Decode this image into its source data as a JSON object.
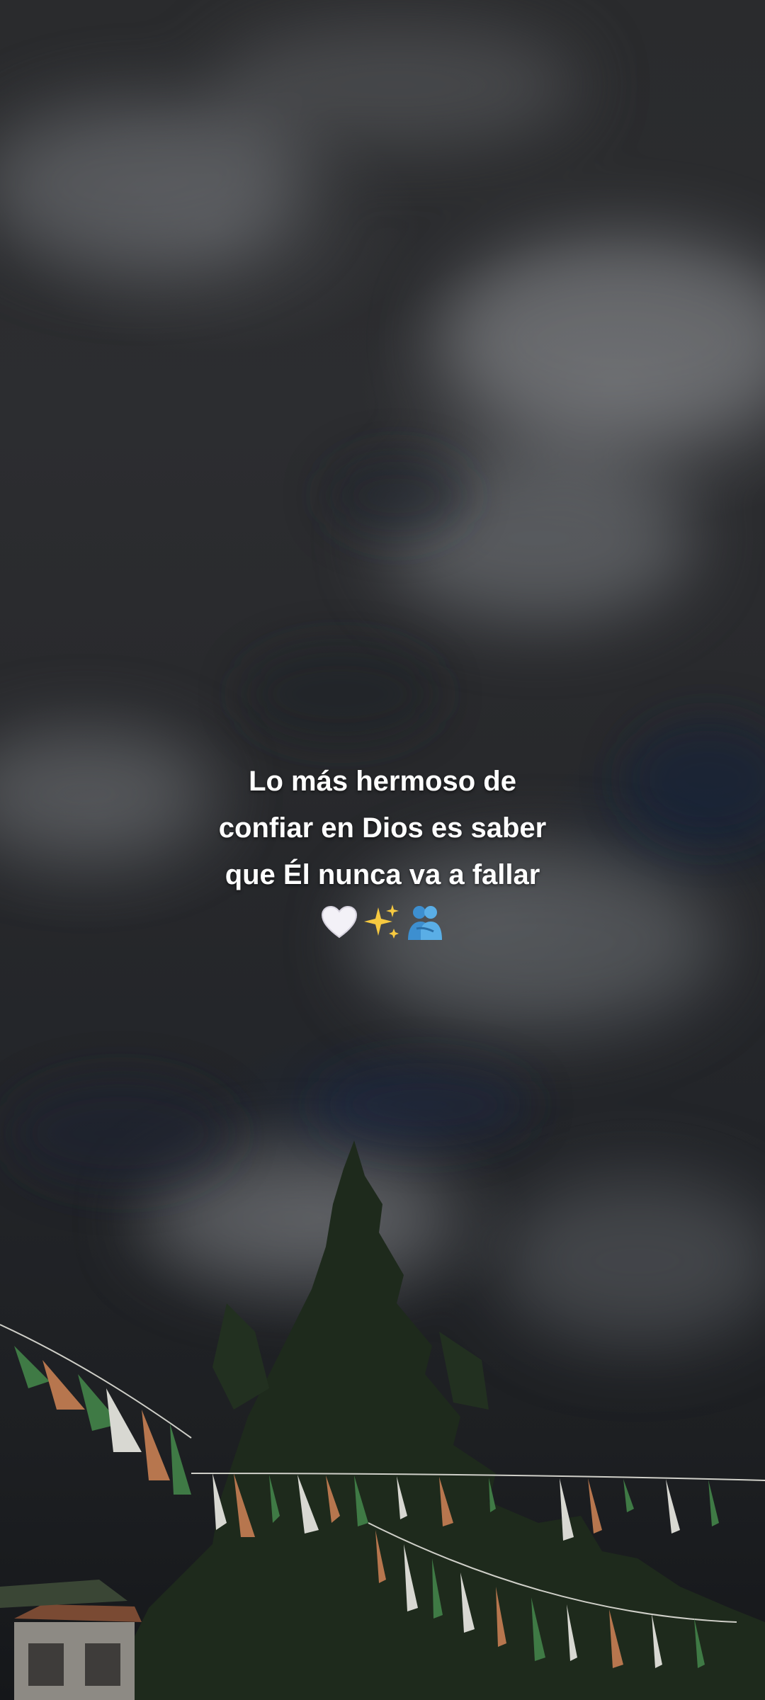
{
  "caption": {
    "lines": [
      "Lo más hermoso de",
      "confiar en Dios es saber",
      "que Él nunca va a fallar"
    ],
    "emojis": [
      "white-heart-icon",
      "sparkles-icon",
      "people-hugging-icon"
    ]
  },
  "colors": {
    "text": "#ffffff",
    "sky": "#2a2b2d",
    "tree": "#1f2a1c",
    "ribbon_green": "#3f7a45",
    "ribbon_orange": "#b7764e",
    "ribbon_white": "#d8d8d2"
  }
}
